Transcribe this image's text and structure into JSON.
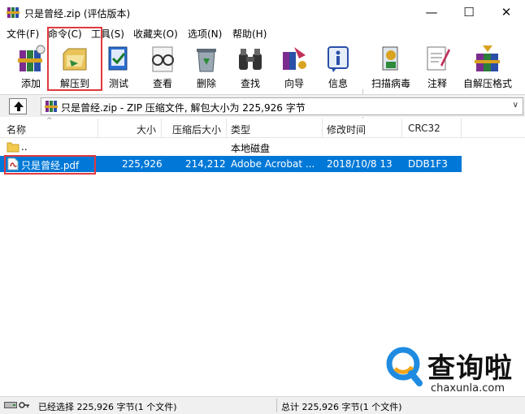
{
  "window": {
    "title": "只是曾经.zip (评估版本)",
    "min_glyph": "—",
    "max_glyph": "☐",
    "close_glyph": "✕"
  },
  "menu": [
    "文件(F)",
    "命令(C)",
    "工具(S)",
    "收藏夹(O)",
    "选项(N)",
    "帮助(H)"
  ],
  "toolbar": {
    "buttons": [
      {
        "label": "添加",
        "icon": "add-books-icon"
      },
      {
        "label": "解压到",
        "icon": "extract-to-icon"
      },
      {
        "label": "测试",
        "icon": "test-icon"
      },
      {
        "label": "查看",
        "icon": "view-glasses-icon"
      },
      {
        "label": "删除",
        "icon": "delete-recycle-icon"
      },
      {
        "label": "查找",
        "icon": "find-binoculars-icon"
      },
      {
        "label": "向导",
        "icon": "wizard-icon"
      },
      {
        "label": "信息",
        "icon": "info-icon"
      },
      {
        "label": "扫描病毒",
        "icon": "virus-scan-icon"
      },
      {
        "label": "注释",
        "icon": "comment-icon"
      },
      {
        "label": "自解压格式",
        "icon": "sfx-icon"
      }
    ]
  },
  "address": {
    "up_glyph": "⬆",
    "text": "只是曾经.zip - ZIP 压缩文件, 解包大小为 225,926 字节",
    "chevron": "∨"
  },
  "columns": {
    "name": "名称",
    "size": "大小",
    "packed": "压缩后大小",
    "type": "类型",
    "modified": "修改时间",
    "crc": "CRC32",
    "sort_glyph": "^"
  },
  "rows": [
    {
      "name": "..",
      "size": "",
      "packed": "",
      "type": "本地磁盘",
      "modified": "",
      "crc": ""
    },
    {
      "name": "只是曾经.pdf",
      "size": "225,926",
      "packed": "214,212",
      "type": "Adobe Acrobat ...",
      "modified": "2018/10/8 13",
      "crc": "DDB1F3"
    }
  ],
  "status": {
    "left": "已经选择 225,926 字节(1 个文件)",
    "right": "总计 225,926 字节(1 个文件)"
  },
  "watermark": {
    "brand": "查询啦",
    "domain": "chaxunla.com"
  },
  "colors": {
    "selection": "#0078d7",
    "highlight_box": "#e0393e",
    "watermark_blue": "#1e8be0"
  }
}
